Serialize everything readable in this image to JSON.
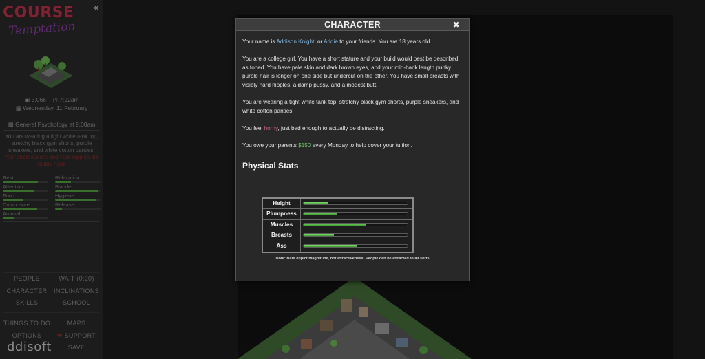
{
  "sidebar": {
    "logo_main": "COURSE",
    "logo_sub": "Temptation",
    "back_arrow": "←",
    "forward_arrow": "→",
    "collapse": "«",
    "money": "3,066",
    "time": "7:22am",
    "date": "Wednesday, 11 February",
    "class": "General Psychology at 9:00am",
    "outfit_text": "You are wearing a tight white tank top, stretchy black gym shorts, purple sneakers, and white cotton panties.",
    "outfit_warn": "Your short stature and your nipples are visibly hard.",
    "meters": [
      {
        "label": "Rest",
        "value": 0.78
      },
      {
        "label": "Relaxation",
        "value": 0.35
      },
      {
        "label": "Attention",
        "value": 0.7
      },
      {
        "label": "Bladder",
        "value": 0.95
      },
      {
        "label": "Food",
        "value": 0.45
      },
      {
        "label": "Hygiene",
        "value": 0.9
      },
      {
        "label": "Composure",
        "value": 0.75
      },
      {
        "label": "Release",
        "value": 0.15
      },
      {
        "label": "Arousal",
        "value": 0.25
      }
    ],
    "menu": {
      "people": "PEOPLE",
      "wait": "WAIT (0:20)",
      "character": "CHARACTER",
      "inclinations": "INCLINATIONS",
      "skills": "SKILLS",
      "school": "SCHOOL",
      "things_to_do": "THINGS TO DO",
      "maps": "MAPS",
      "options": "OPTIONS",
      "support": "SUPPORT",
      "save": "SAVE"
    },
    "watermark": "ddisoft"
  },
  "modal": {
    "title": "CHARACTER",
    "close": "✖",
    "intro_pre": "Your name is ",
    "full_name": "Addison Knight",
    "intro_mid": ", or ",
    "nickname": "Addie",
    "intro_post": " to your friends. You are 18 years old.",
    "description": "You are a college girl. You have a short stature and your build would best be described as toned. You have pale skin and dark brown eyes, and your mid-back length punky purple hair is longer on one side but undercut on the other. You have small breasts with visibly hard nipples, a damp pussy, and a modest butt.",
    "wearing": "You are wearing a tight white tank top, stretchy black gym shorts, purple sneakers, and white cotton panties.",
    "feel_pre": "You feel ",
    "feel_state": "horny",
    "feel_post": ", just bad enough to actually be distracting.",
    "owe_pre": "You owe your parents ",
    "owe_amount": "$150",
    "owe_post": " every Monday to help cover your tuition.",
    "physical_title": "Physical Stats",
    "stats": [
      {
        "label": "Height",
        "value": 0.24
      },
      {
        "label": "Plumpness",
        "value": 0.32
      },
      {
        "label": "Muscles",
        "value": 0.6
      },
      {
        "label": "Breasts",
        "value": 0.29
      },
      {
        "label": "Ass",
        "value": 0.51
      }
    ],
    "note": "Note: Bars depict magnitude, not attractiveness! People can be attracted to all sorts!"
  },
  "colors": {
    "link": "#7fb3e0",
    "mood": "#c0608a",
    "money": "#6fc26a",
    "bar_fill": "#5cbf48"
  }
}
